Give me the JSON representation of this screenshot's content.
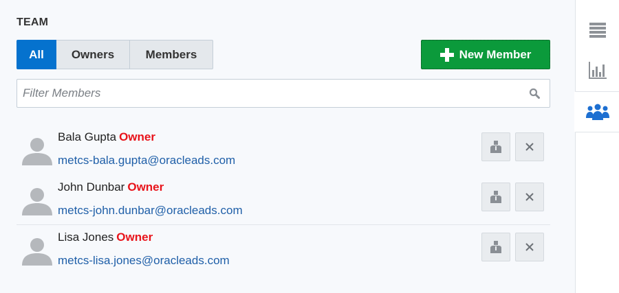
{
  "team": {
    "title": "TEAM",
    "tabs": [
      {
        "label": "All",
        "active": true
      },
      {
        "label": "Owners",
        "active": false
      },
      {
        "label": "Members",
        "active": false
      }
    ],
    "new_member_label": "New Member",
    "filter": {
      "placeholder": "Filter Members",
      "value": ""
    },
    "members": [
      {
        "name": "Bala Gupta",
        "role": "Owner",
        "email": "metcs-bala.gupta@oracleads.com"
      },
      {
        "name": "John Dunbar",
        "role": "Owner",
        "email": "metcs-john.dunbar@oracleads.com"
      },
      {
        "name": "Lisa Jones",
        "role": "Owner",
        "email": "metcs-lisa.jones@oracleads.com"
      }
    ]
  },
  "rail": {
    "items": [
      {
        "icon": "list-icon",
        "active": false
      },
      {
        "icon": "bar-chart-icon",
        "active": false
      },
      {
        "icon": "team-icon",
        "active": true
      }
    ]
  },
  "colors": {
    "accent": "#0572ce",
    "new_button": "#0b9a3b",
    "owner_role": "#e8141b",
    "email_link": "#1f5fa8"
  }
}
